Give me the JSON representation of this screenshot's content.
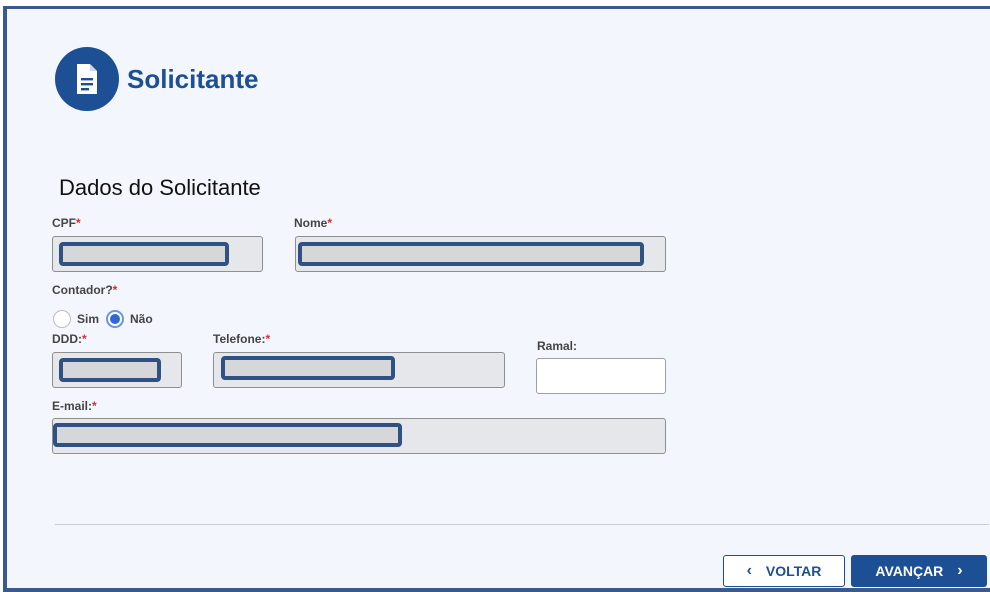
{
  "header": {
    "title": "Solicitante",
    "icon": "document-icon"
  },
  "section": {
    "title": "Dados do Solicitante"
  },
  "fields": {
    "cpf": {
      "label": "CPF",
      "required_mark": "*"
    },
    "nome": {
      "label": "Nome",
      "required_mark": "*"
    },
    "contador": {
      "label": "Contador?",
      "required_mark": "*",
      "options": [
        "Sim",
        "Não"
      ],
      "selected": "Não"
    },
    "ddd": {
      "label": "DDD:",
      "required_mark": "*"
    },
    "telefone": {
      "label": "Telefone:",
      "required_mark": "*"
    },
    "ramal": {
      "label": "Ramal:"
    },
    "email": {
      "label": "E-mail:",
      "required_mark": "*"
    }
  },
  "actions": {
    "back_label": "VOLTAR",
    "next_label": "AVANÇAR",
    "back_icon": "chevron-left-icon",
    "next_icon": "chevron-right-icon"
  },
  "colors": {
    "primary": "#1d4f95",
    "required": "#d32f2f",
    "redaction": "#2f5283",
    "background": "#f3f6fc"
  }
}
